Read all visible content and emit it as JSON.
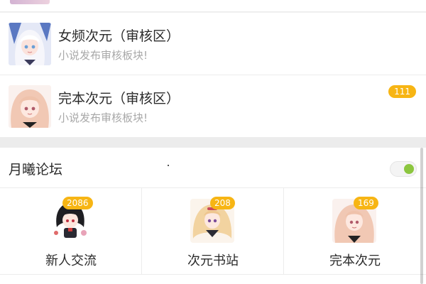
{
  "forum_list": {
    "items": [
      {
        "title": "女频次元（审核区）",
        "subtitle": "小说发布审核板块!",
        "avatar_icon": "anime-girl-white-hair-icon",
        "badge": ""
      },
      {
        "title": "完本次元（审核区）",
        "subtitle": "小说发布审核板块!",
        "avatar_icon": "anime-girl-pink-twintails-icon",
        "badge": "111"
      }
    ]
  },
  "section": {
    "title": "月曦论坛",
    "toggle_on": true,
    "boards": [
      {
        "label": "新人交流",
        "count": "2086",
        "icon": "chibi-girl-black-hair-icon"
      },
      {
        "label": "次元书站",
        "count": "208",
        "icon": "anime-girl-blonde-twintails-icon"
      },
      {
        "label": "完本次元",
        "count": "169",
        "icon": "anime-girl-pink-hair-icon"
      }
    ]
  },
  "colors": {
    "badge": "#f7b514",
    "toggle_knob": "#8cc63f",
    "text": "#2b2b2b",
    "subtext": "#a8a8a8"
  }
}
